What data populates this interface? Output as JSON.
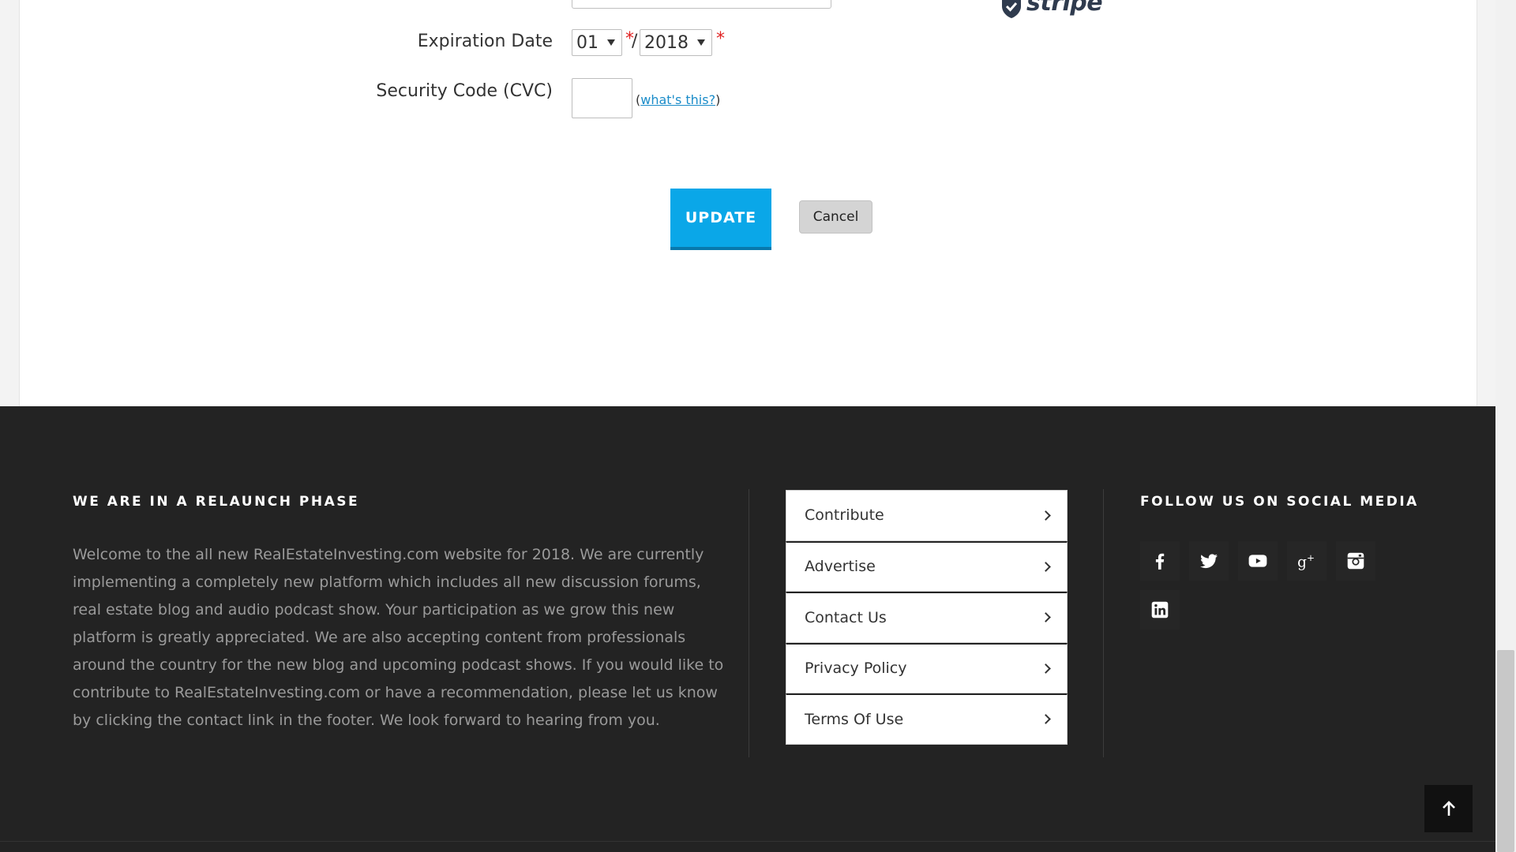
{
  "form": {
    "expiration_label": "Expiration Date",
    "month_value": "01",
    "year_value": "2018",
    "required_mark": "*",
    "separator": "/",
    "cvc_label": "Security Code (CVC)",
    "cvc_value": "",
    "cvc_help_open": "(",
    "cvc_help_link": "what's this?",
    "cvc_help_close": ")",
    "update_label": "UPDATE",
    "cancel_label": "Cancel"
  },
  "badge": {
    "brand_text": "stripe",
    "icon": "shield-check-icon"
  },
  "footer": {
    "about_heading": "WE ARE IN A RELAUNCH PHASE",
    "about_text": "Welcome to the all new RealEstateInvesting.com website for 2018. We are currently implementing a completely new platform which includes all new discussion forums, real estate blog and audio podcast show. Your participation as we grow this new platform is greatly appreciated. We are also accepting content from professionals around the country for the new blog and upcoming podcast shows. If you would like to contribute to RealEstateInvesting.com or have a recommendation, please let us know by clicking the contact link in the footer. We look forward to hearing from you.",
    "menu": [
      {
        "label": "Contribute"
      },
      {
        "label": "Advertise"
      },
      {
        "label": "Contact Us"
      },
      {
        "label": "Privacy Policy"
      },
      {
        "label": "Terms Of Use"
      }
    ],
    "social_heading": "FOLLOW US ON SOCIAL MEDIA",
    "social": [
      {
        "icon": "facebook-icon"
      },
      {
        "icon": "twitter-icon"
      },
      {
        "icon": "youtube-icon"
      },
      {
        "icon": "google-plus-icon"
      },
      {
        "icon": "instagram-icon"
      },
      {
        "icon": "linkedin-icon"
      }
    ]
  },
  "colors": {
    "update_button": "#0aa7e8",
    "footer_bg": "#232323",
    "link": "#1a8cc9",
    "required": "#e02020"
  }
}
